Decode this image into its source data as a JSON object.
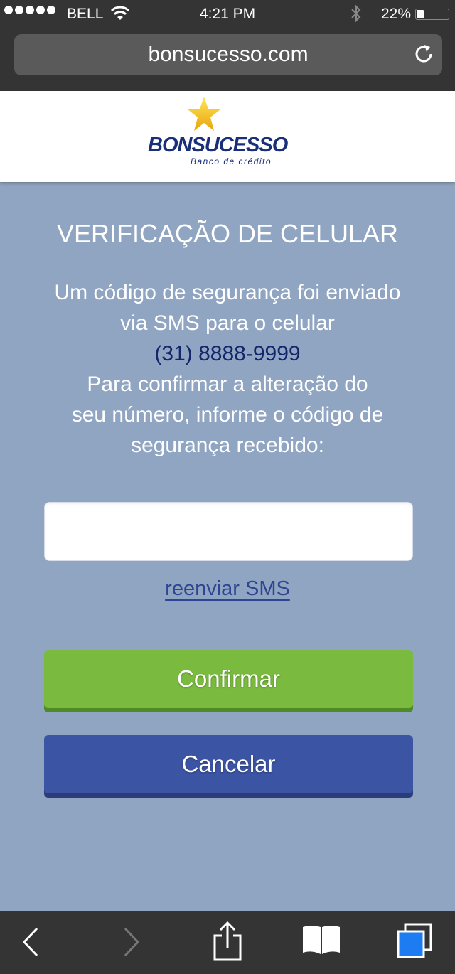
{
  "status_bar": {
    "carrier": "BELL",
    "time": "4:21 PM",
    "battery_percent": "22%",
    "battery_level": 0.22,
    "signal_bars": 5
  },
  "browser": {
    "url": "bonsucesso.com",
    "icons": {
      "reload": "reload-icon",
      "back": "back-icon",
      "forward": "forward-icon",
      "share": "share-icon",
      "bookmarks": "bookmarks-icon",
      "tabs": "tabs-icon"
    }
  },
  "logo": {
    "name": "BONSUCESSO",
    "tagline": "Banco de crédito"
  },
  "verification": {
    "title": "VERIFICAÇÃO DE CELULAR",
    "message_lines": [
      "Um código de segurança foi enviado",
      "via SMS para o celular"
    ],
    "phone": "(31) 8888-9999",
    "instruction_lines": [
      "Para confirmar a alteração do",
      "seu número, informe o código de",
      "segurança recebido:"
    ],
    "code_value": "",
    "code_placeholder": "",
    "resend_label": "reenviar SMS",
    "confirm_label": "Confirmar",
    "cancel_label": "Cancelar"
  },
  "colors": {
    "page_background": "#90a5c1",
    "brand_navy": "#1a2f7a",
    "confirm_green": "#7abb3f",
    "cancel_blue": "#3c54a4",
    "chrome_dark": "#343434"
  }
}
